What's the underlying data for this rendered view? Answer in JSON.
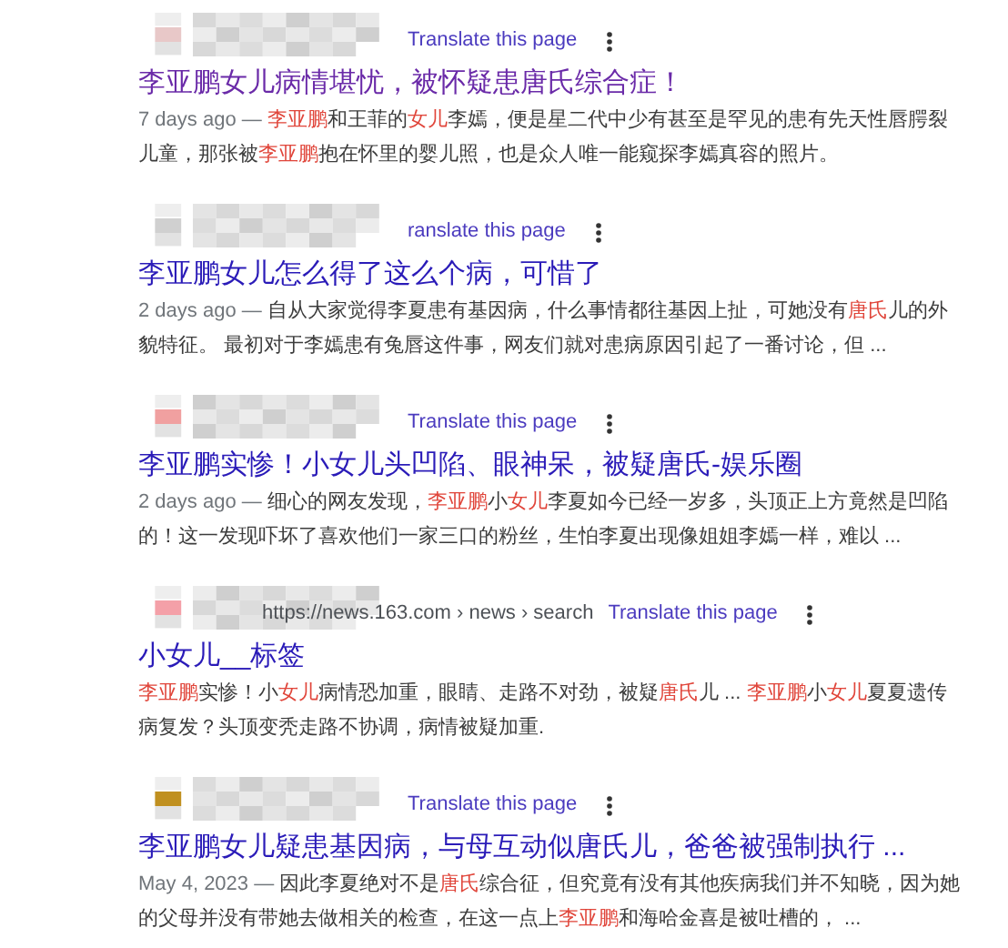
{
  "results": [
    {
      "translate": "Translate this page",
      "title": "李亚鹏女儿病情堪忧，被怀疑患唐氏综合症！",
      "visited": true,
      "date": "7 days ago — ",
      "snippet": [
        {
          "text": "李亚鹏",
          "highlight": true
        },
        {
          "text": "和王菲的",
          "highlight": false
        },
        {
          "text": "女儿",
          "highlight": true
        },
        {
          "text": "李嫣，便是星二代中少有甚至是罕见的患有先天性唇腭裂儿童，那张被",
          "highlight": false
        },
        {
          "text": "李亚鹏",
          "highlight": true
        },
        {
          "text": "抱在怀里的婴儿照，也是众人唯一能窥探李嫣真容的照片。",
          "highlight": false
        }
      ]
    },
    {
      "translate": "ranslate this page",
      "title": "李亚鹏女儿怎么得了这么个病，可惜了",
      "visited": false,
      "date": "2 days ago — ",
      "snippet": [
        {
          "text": "自从大家觉得李夏患有基因病，什么事情都往基因上扯，可她没有",
          "highlight": false
        },
        {
          "text": "唐氏",
          "highlight": true
        },
        {
          "text": "儿的外貌特征。 最初对于李嫣患有兔唇这件事，网友们就对患病原因引起了一番讨论，但 ...",
          "highlight": false
        }
      ]
    },
    {
      "translate": "Translate this page",
      "title": "李亚鹏实惨！小女儿头凹陷、眼神呆，被疑唐氏-娱乐圈",
      "visited": false,
      "date": "2 days ago — ",
      "snippet": [
        {
          "text": "细心的网友发现，",
          "highlight": false
        },
        {
          "text": "李亚鹏",
          "highlight": true
        },
        {
          "text": "小",
          "highlight": false
        },
        {
          "text": "女儿",
          "highlight": true
        },
        {
          "text": "李夏如今已经一岁多，头顶正上方竟然是凹陷的！这一发现吓坏了喜欢他们一家三口的粉丝，生怕李夏出现像姐姐李嫣一样，难以 ...",
          "highlight": false
        }
      ]
    },
    {
      "url": "https://news.163.com › news › search",
      "translate": "Translate this page",
      "title": "小女儿__标签",
      "visited": false,
      "snippet": [
        {
          "text": "李亚鹏",
          "highlight": true
        },
        {
          "text": "实惨！小",
          "highlight": false
        },
        {
          "text": "女儿",
          "highlight": true
        },
        {
          "text": "病情恐加重，眼睛、走路不对劲，被疑",
          "highlight": false
        },
        {
          "text": "唐氏",
          "highlight": true
        },
        {
          "text": "儿 ... ",
          "highlight": false
        },
        {
          "text": "李亚鹏",
          "highlight": true
        },
        {
          "text": "小",
          "highlight": false
        },
        {
          "text": "女儿",
          "highlight": true
        },
        {
          "text": "夏夏遗传病复发？头顶变秃走路不协调，病情被疑加重.",
          "highlight": false
        }
      ]
    },
    {
      "translate": "Translate this page",
      "title": "李亚鹏女儿疑患基因病，与母互动似唐氏儿，爸爸被强制执行 ...",
      "visited": false,
      "date": "May 4, 2023 — ",
      "snippet": [
        {
          "text": "因此李夏绝对不是",
          "highlight": false
        },
        {
          "text": "唐氏",
          "highlight": true
        },
        {
          "text": "综合征，但究竟有没有其他疾病我们并不知晓，因为她的父母并没有带她去做相关的检查，在这一点上",
          "highlight": false
        },
        {
          "text": "李亚鹏",
          "highlight": true
        },
        {
          "text": "和海哈金喜是被吐槽的，  ...",
          "highlight": false
        }
      ]
    }
  ]
}
